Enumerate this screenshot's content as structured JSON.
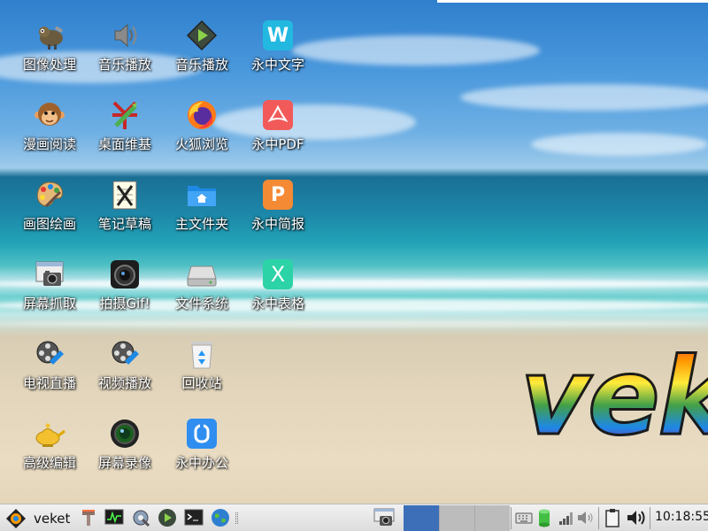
{
  "desktop": {
    "icons": [
      {
        "label": "图像处理",
        "icon": "gimp-icon"
      },
      {
        "label": "音乐播放",
        "icon": "speaker-icon"
      },
      {
        "label": "音乐播放",
        "icon": "media-player-icon"
      },
      {
        "label": "永中文字",
        "icon": "yozo-writer-icon"
      },
      {
        "label": "漫画阅读",
        "icon": "monkey-icon"
      },
      {
        "label": "桌面维基",
        "icon": "wiki-icon"
      },
      {
        "label": "火狐浏览",
        "icon": "firefox-icon"
      },
      {
        "label": "永中PDF",
        "icon": "yozo-pdf-icon"
      },
      {
        "label": "画图绘画",
        "icon": "palette-icon"
      },
      {
        "label": "笔记草稿",
        "icon": "notepad-icon"
      },
      {
        "label": "主文件夹",
        "icon": "home-folder-icon"
      },
      {
        "label": "永中简报",
        "icon": "yozo-presentation-icon"
      },
      {
        "label": "屏幕抓取",
        "icon": "screenshot-icon"
      },
      {
        "label": "拍摄Gif!",
        "icon": "camera-icon"
      },
      {
        "label": "文件系统",
        "icon": "drive-icon"
      },
      {
        "label": "永中表格",
        "icon": "yozo-spreadsheet-icon"
      },
      {
        "label": "电视直播",
        "icon": "tv-reel-icon"
      },
      {
        "label": "视频播放",
        "icon": "video-reel-icon"
      },
      {
        "label": "回收站",
        "icon": "recycle-bin-icon"
      },
      {
        "label": "高级编辑",
        "icon": "lamp-icon"
      },
      {
        "label": "屏幕录像",
        "icon": "lens-icon"
      },
      {
        "label": "永中办公",
        "icon": "yozo-office-icon"
      }
    ],
    "logo_text": "veke"
  },
  "taskbar": {
    "menu_label": "veket",
    "launchers": [
      "paintbrush-icon",
      "system-monitor-icon",
      "settings-icon",
      "media-play-icon",
      "terminal-icon",
      "globe-icon"
    ],
    "workspaces": [
      "workspace-1",
      "workspace-2",
      "workspace-3"
    ],
    "tray": [
      "keyboard-icon",
      "database-icon",
      "network-signal-icon",
      "volume-small-icon",
      "clipboard-icon",
      "volume-icon"
    ],
    "clock": "10:18:55"
  },
  "colors": {
    "workspace_active": "#3c6fb8",
    "workspace_inactive": "#bcbcbc",
    "yozo_writer": "#22b8e0",
    "yozo_pdf": "#f25a5a",
    "yozo_presentation": "#f58a35",
    "yozo_spreadsheet": "#2bd3a6",
    "yozo_office": "#2f8ef0"
  }
}
